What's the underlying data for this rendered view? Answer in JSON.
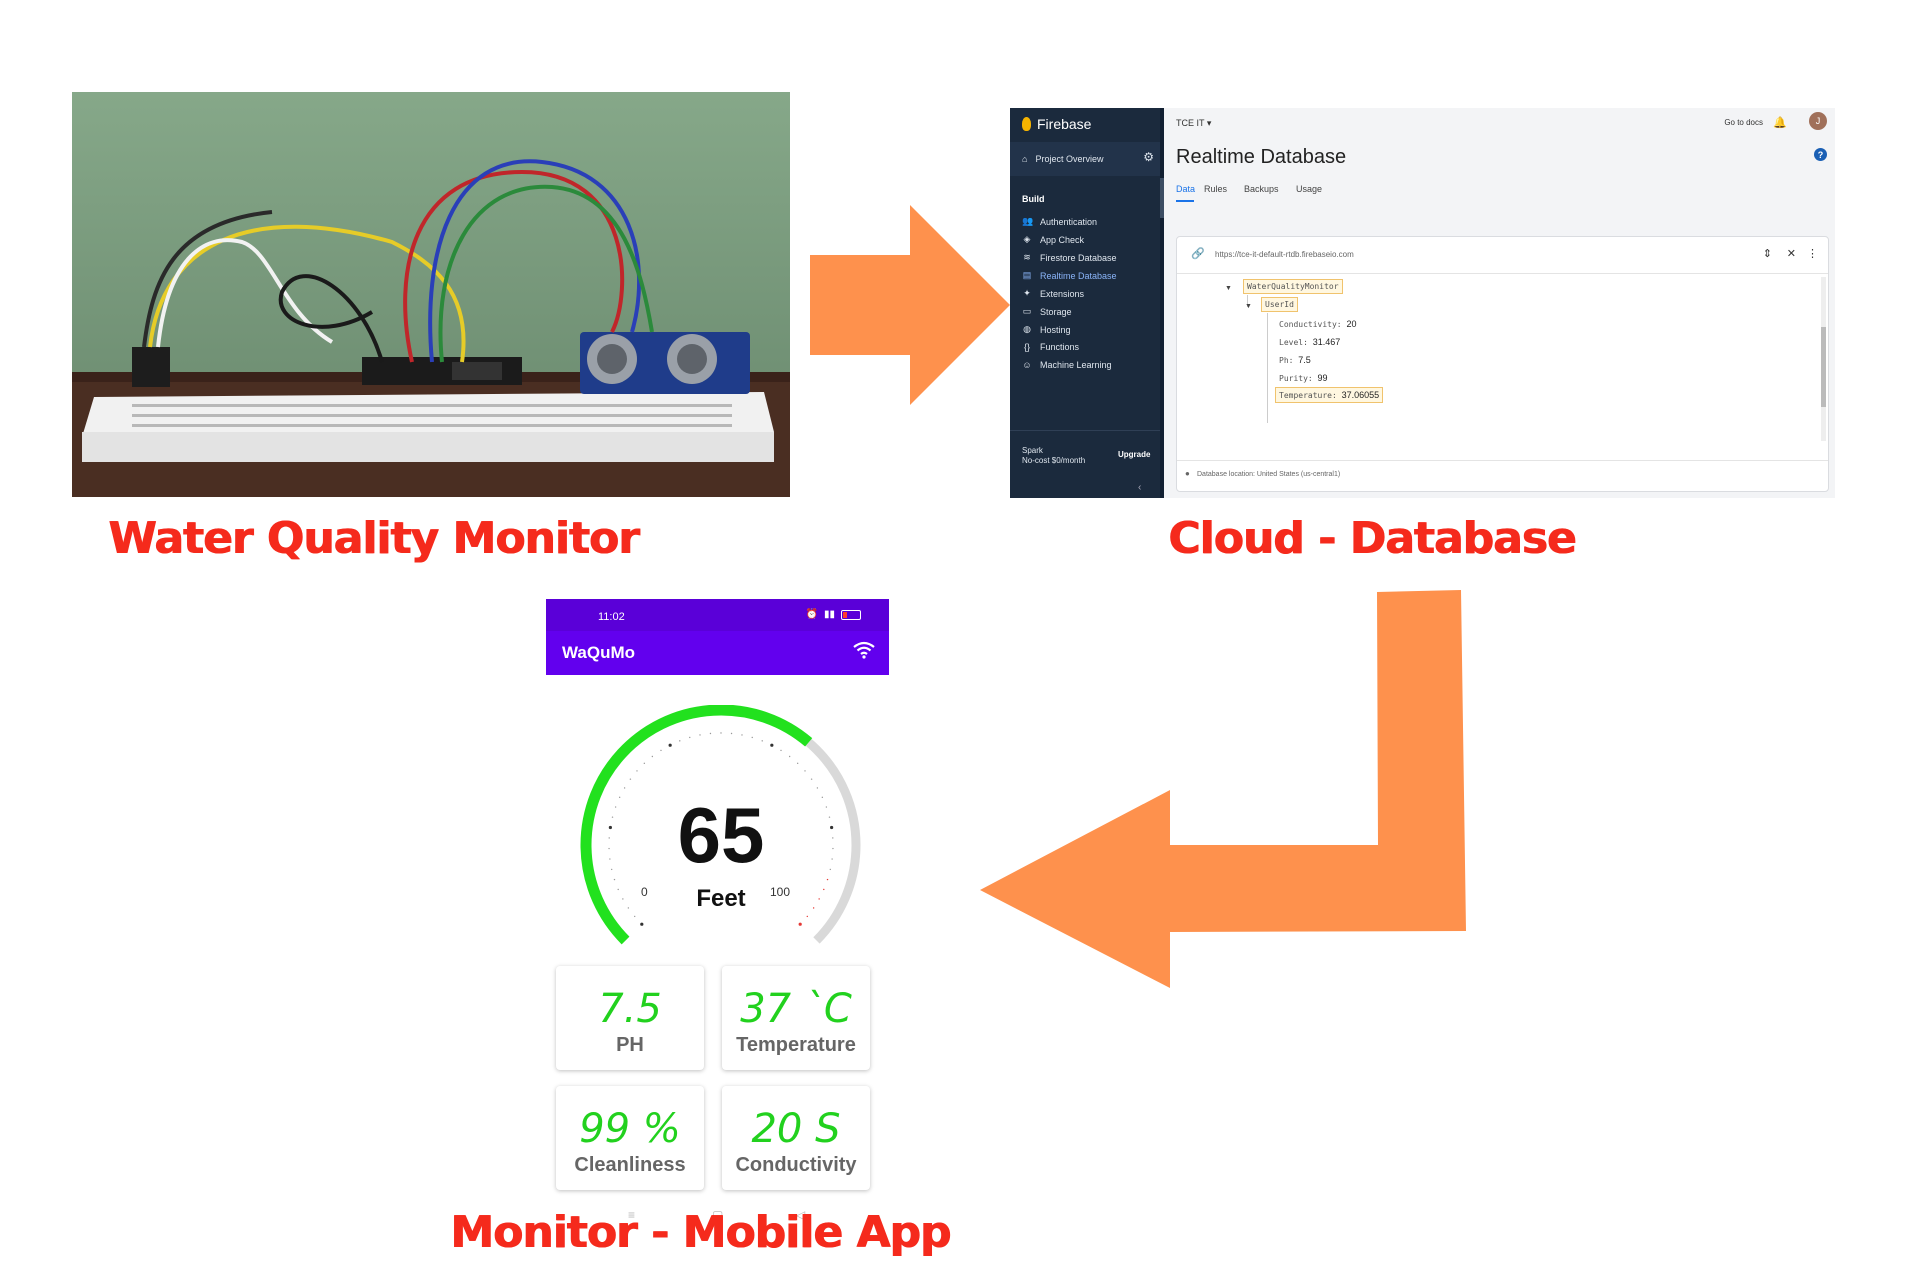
{
  "captions": {
    "monitor": "Water Quality Monitor",
    "cloud": "Cloud - Database",
    "mobile": "Monitor - Mobile App"
  },
  "firebase": {
    "brand": "Firebase",
    "project_overview": "Project Overview",
    "build_heading": "Build",
    "nav": [
      "Authentication",
      "App Check",
      "Firestore Database",
      "Realtime Database",
      "Extensions",
      "Storage",
      "Hosting",
      "Functions",
      "Machine Learning"
    ],
    "active_nav": "Realtime Database",
    "plan_name": "Spark",
    "plan_price": "No-cost $0/month",
    "upgrade": "Upgrade",
    "project": "TCE IT",
    "go_to_docs": "Go to docs",
    "avatar_letter": "J",
    "title": "Realtime Database",
    "tabs": [
      "Data",
      "Rules",
      "Backups",
      "Usage"
    ],
    "url": "https://tce-it-default-rtdb.firebaseio.com",
    "tree": {
      "root": "WaterQualityMonitor",
      "child": "UserId",
      "fields": [
        {
          "key": "Conductivity",
          "value": "20"
        },
        {
          "key": "Level",
          "value": "31.467"
        },
        {
          "key": "Ph",
          "value": "7.5"
        },
        {
          "key": "Purity",
          "value": "99"
        },
        {
          "key": "Temperature",
          "value": "37.06055"
        }
      ]
    },
    "location": "Database location: United States (us-central1)"
  },
  "mobile": {
    "time": "11:02",
    "app_title": "WaQuMo",
    "gauge": {
      "value": "65",
      "unit": "Feet",
      "min": "0",
      "max": "100",
      "fraction": 0.65
    },
    "cards": [
      {
        "value": "7.5",
        "label": "PH"
      },
      {
        "value": "37 `C",
        "label": "Temperature"
      },
      {
        "value": "99 %",
        "label": "Cleanliness"
      },
      {
        "value": "20 S",
        "label": "Conductivity"
      }
    ]
  },
  "colors": {
    "caption": "#f52a1c",
    "arrow": "#fe914d",
    "app_bar": "#6200ee",
    "gauge_active": "#22e11e",
    "gauge_track": "#d9d9d9"
  }
}
